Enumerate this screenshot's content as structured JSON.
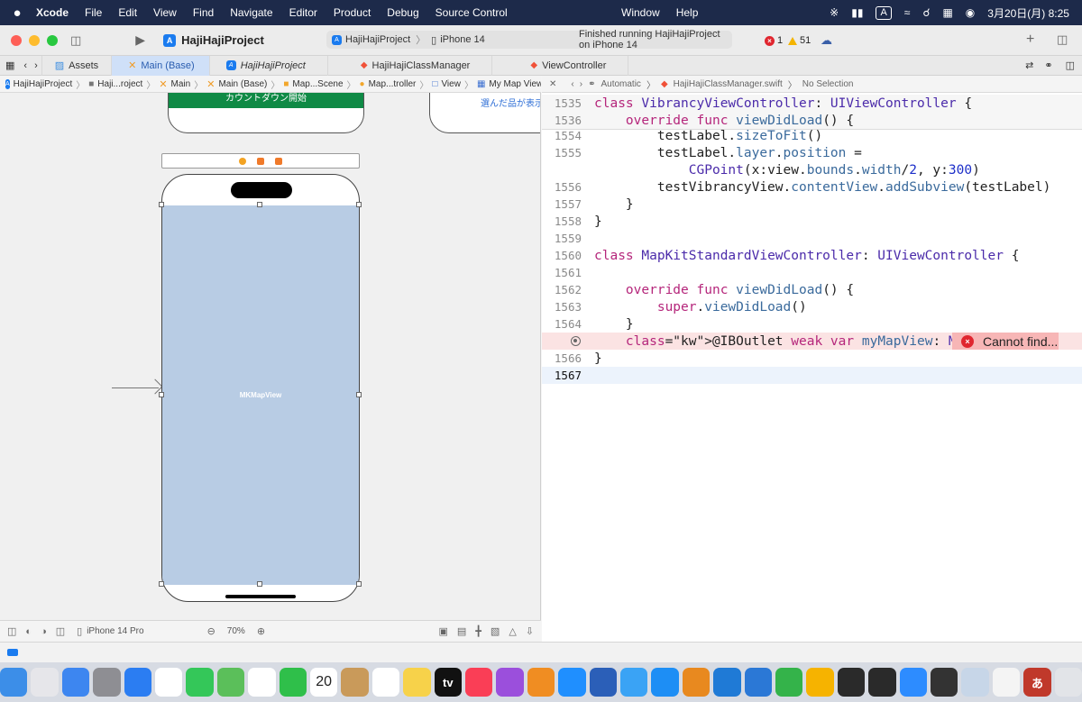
{
  "menubar": {
    "apple": "",
    "app": "Xcode",
    "items": [
      "File",
      "Edit",
      "View",
      "Find",
      "Navigate",
      "Editor",
      "Product",
      "Debug",
      "Source Control"
    ],
    "window_items": [
      "Window",
      "Help"
    ],
    "input_mode": "A",
    "clock": "3月20日(月) 8:25"
  },
  "toolbar": {
    "project_title": "HajiHajiProject",
    "scheme": "HajiHajiProject",
    "device": "iPhone 14",
    "status": "Finished running HajiHajiProject on iPhone 14",
    "error_count": "1",
    "warning_count": "51"
  },
  "tabs": [
    {
      "label": "Assets"
    },
    {
      "label": "Main (Base)"
    },
    {
      "label": "HajiHajiProject"
    },
    {
      "label": "HajiHajiClassManager"
    },
    {
      "label": "ViewController"
    }
  ],
  "left_breadcrumb": [
    "HajiHajiProject",
    "Haji...roject",
    "Main",
    "Main (Base)",
    "Map...Scene",
    "Map...troller",
    "View",
    "My Map View"
  ],
  "right_breadcrumb": {
    "mode": "Automatic",
    "file": "HajiHajiClassManager.swift",
    "selection": "No Selection"
  },
  "canvas": {
    "countdown_button": "カウントダウン開始",
    "second_scene_text": "選んだ品が表示",
    "map_view_label": "MKMapView"
  },
  "left_bottom": {
    "device": "iPhone 14 Pro",
    "zoom": "70%"
  },
  "editor": {
    "sticky": [
      {
        "n": "1535",
        "code": "class VibrancyViewController: UIViewController {"
      },
      {
        "n": "1536",
        "code": "    override func viewDidLoad() {"
      }
    ],
    "lines": [
      {
        "n": "1554",
        "code": "        testLabel.sizeToFit()"
      },
      {
        "n": "1555",
        "code": "        testLabel.layer.position ="
      },
      {
        "n": "",
        "code": "            CGPoint(x:view.bounds.width/2, y:300)"
      },
      {
        "n": "1556",
        "code": "        testVibrancyView.contentView.addSubview(testLabel)"
      },
      {
        "n": "1557",
        "code": "    }"
      },
      {
        "n": "1558",
        "code": "}"
      },
      {
        "n": "1559",
        "code": ""
      },
      {
        "n": "1560",
        "code": "class MapKitStandardViewController: UIViewController {"
      },
      {
        "n": "1561",
        "code": ""
      },
      {
        "n": "1562",
        "code": "    override func viewDidLoad() {"
      },
      {
        "n": "1563",
        "code": "        super.viewDidLoad()"
      },
      {
        "n": "1564",
        "code": "    }"
      },
      {
        "n": "",
        "code": "    @IBOutlet weak var myMapView: MKMapView!"
      },
      {
        "n": "1566",
        "code": "}"
      },
      {
        "n": "1567",
        "code": ""
      }
    ],
    "error_message": "Cannot find..."
  },
  "colors": {
    "menubar_bg": "#1d2a4a",
    "tab_active_bg": "#cfe0f8",
    "map_view_fill": "#b8cce4",
    "countdown_button": "#0f8a45",
    "error_red": "#e0262f",
    "keyword": "#b5267b",
    "type": "#4b2baa"
  },
  "dock_icons": [
    "finder-icon",
    "launchpad-icon",
    "mail-icon",
    "system-settings-icon",
    "safari-icon",
    "chrome-icon",
    "messages-icon",
    "maps-icon",
    "photos-icon",
    "facetime-icon",
    "calendar-icon",
    "contacts-icon",
    "reminders-icon",
    "notes-icon",
    "tv-icon",
    "music-icon",
    "podcasts-icon",
    "books-icon",
    "xcode-icon",
    "instruments-icon",
    "testflight-icon",
    "app-store-icon",
    "pages-icon",
    "vscode-icon",
    "keynote-icon",
    "numbers-icon",
    "pencil-icon",
    "activity-icon",
    "terminal-icon",
    "zoom-icon",
    "calculator-icon",
    "preview-icon",
    "textedit-icon",
    "kana-icon",
    "trash-icon"
  ],
  "calendar_date": "20",
  "tv_label": "tv",
  "kana_label": "あ"
}
